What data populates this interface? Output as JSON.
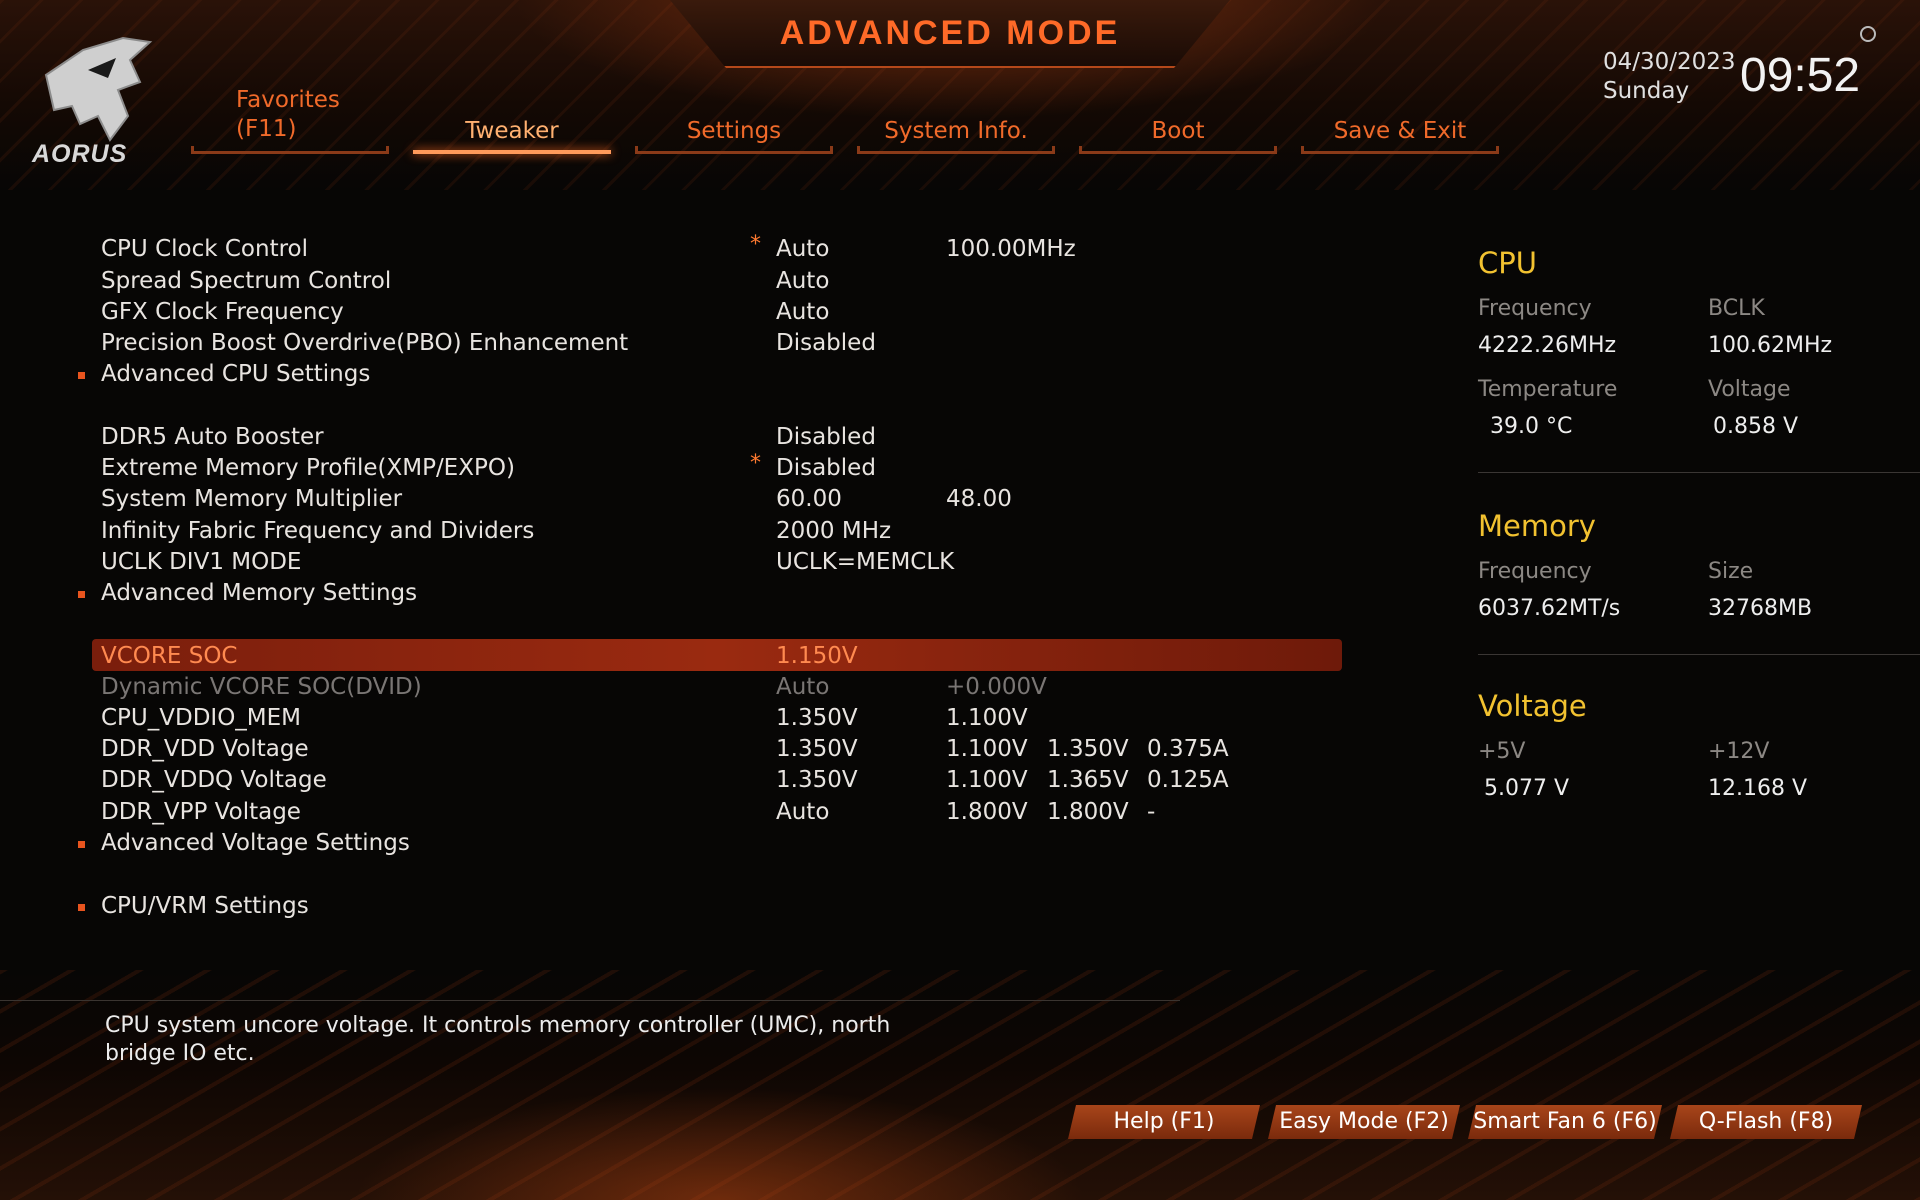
{
  "header": {
    "title": "ADVANCED MODE",
    "logo_text": "AORUS",
    "date": "04/30/2023",
    "day": "Sunday",
    "time": "09:52"
  },
  "tabs": {
    "favorites_line1": "Favorites",
    "favorites_line2": "(F11)",
    "tweaker": "Tweaker",
    "settings": "Settings",
    "system_info": "System Info.",
    "boot": "Boot",
    "save_exit": "Save & Exit",
    "active": "Tweaker"
  },
  "settings": [
    {
      "label": "CPU Clock Control",
      "star": "*",
      "v1": "Auto",
      "v2": "100.00MHz"
    },
    {
      "label": "Spread Spectrum Control",
      "v1": "Auto"
    },
    {
      "label": "GFX Clock Frequency",
      "v1": "Auto"
    },
    {
      "label": "Precision Boost Overdrive(PBO) Enhancement",
      "v1": "Disabled"
    },
    {
      "label": "Advanced CPU Settings",
      "submenu": true
    },
    {
      "label": "DDR5 Auto Booster",
      "v1": "Disabled"
    },
    {
      "label": "Extreme Memory Profile(XMP/EXPO)",
      "star": "*",
      "v1": "Disabled"
    },
    {
      "label": "System Memory Multiplier",
      "v1": "60.00",
      "v2": "48.00"
    },
    {
      "label": "Infinity Fabric Frequency and Dividers",
      "v1": "2000 MHz"
    },
    {
      "label": "UCLK DIV1 MODE",
      "v1": "UCLK=MEMCLK"
    },
    {
      "label": "Advanced Memory Settings",
      "submenu": true
    },
    {
      "label": "VCORE SOC",
      "v1": "1.150V",
      "selected": true
    },
    {
      "label": "Dynamic VCORE SOC(DVID)",
      "v1": "Auto",
      "v2": "+0.000V",
      "dim": true
    },
    {
      "label": "CPU_VDDIO_MEM",
      "v1": "1.350V",
      "v2": "1.100V"
    },
    {
      "label": "DDR_VDD Voltage",
      "v1": "1.350V",
      "v2": "1.100V",
      "v3": "1.350V",
      "v4": "0.375A"
    },
    {
      "label": "DDR_VDDQ Voltage",
      "v1": "1.350V",
      "v2": "1.100V",
      "v3": "1.365V",
      "v4": "0.125A"
    },
    {
      "label": "DDR_VPP Voltage",
      "v1": "Auto",
      "v2": "1.800V",
      "v3": "1.800V",
      "v4": "-"
    },
    {
      "label": "Advanced Voltage Settings",
      "submenu": true
    },
    {
      "label": "CPU/VRM Settings",
      "submenu": true
    }
  ],
  "monitor": {
    "cpu": {
      "title": "CPU",
      "freq_label": "Frequency",
      "freq": "4222.26MHz",
      "bclk_label": "BCLK",
      "bclk": "100.62MHz",
      "temp_label": "Temperature",
      "temp": "39.0 °C",
      "volt_label": "Voltage",
      "volt": "0.858 V"
    },
    "memory": {
      "title": "Memory",
      "freq_label": "Frequency",
      "freq": "6037.62MT/s",
      "size_label": "Size",
      "size": "32768MB"
    },
    "voltage": {
      "title": "Voltage",
      "p5_label": "+5V",
      "p5": "5.077 V",
      "p12_label": "+12V",
      "p12": "12.168 V"
    }
  },
  "help_text": "CPU system uncore voltage. It controls memory controller (UMC), north bridge IO etc.",
  "footer": {
    "help": "Help (F1)",
    "easy": "Easy Mode (F2)",
    "smartfan": "Smart Fan 6 (F6)",
    "qflash": "Q-Flash (F8)"
  },
  "colors": {
    "accent": "#f06a2a",
    "selection": "#8a240e",
    "panel_heading": "#f2c230"
  }
}
